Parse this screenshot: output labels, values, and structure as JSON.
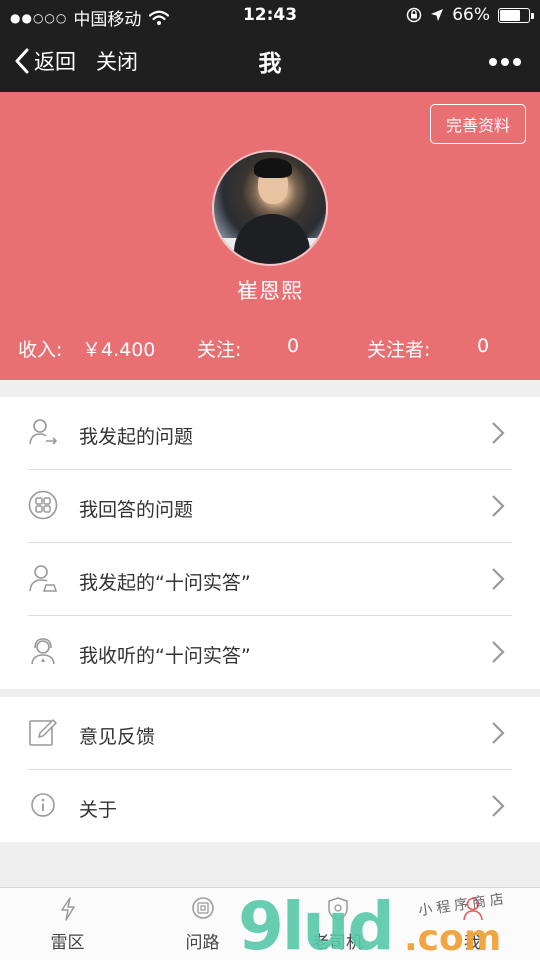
{
  "status_bar": {
    "signal_dots": "●●○○○",
    "carrier": "中国移动",
    "time": "12:43",
    "battery": "66%"
  },
  "nav": {
    "back_label": "返回",
    "close_label": "关闭",
    "title": "我"
  },
  "profile": {
    "edit_label": "完善资料",
    "name": "崔恩熙",
    "income_label": "收入:",
    "income_value": "￥4.400",
    "follow_label": "关注:",
    "follow_value": "0",
    "followers_label": "关注者:",
    "followers_value": "0"
  },
  "menu_group1": [
    {
      "label": "我发起的问题",
      "icon": "user-arrow-icon"
    },
    {
      "label": "我回答的问题",
      "icon": "grid-circle-icon"
    },
    {
      "label": "我发起的“十问实答”",
      "icon": "user-pen-icon"
    },
    {
      "label": "我收听的“十问实答”",
      "icon": "headset-user-icon"
    }
  ],
  "menu_group2": [
    {
      "label": "意见反馈",
      "icon": "edit-icon"
    },
    {
      "label": "关于",
      "icon": "info-icon"
    }
  ],
  "tabs": [
    {
      "label": "雷区",
      "icon": "lightning-icon"
    },
    {
      "label": "问路",
      "icon": "ask-icon"
    },
    {
      "label": "老司机",
      "icon": "shield-icon"
    },
    {
      "label": "我",
      "icon": "person-icon"
    }
  ],
  "watermark": {
    "big": "9lud",
    "com": ".com",
    "small": "小程序商店"
  },
  "colors": {
    "header_bg": "#e87073",
    "nav_bg": "#1f1f1f"
  }
}
